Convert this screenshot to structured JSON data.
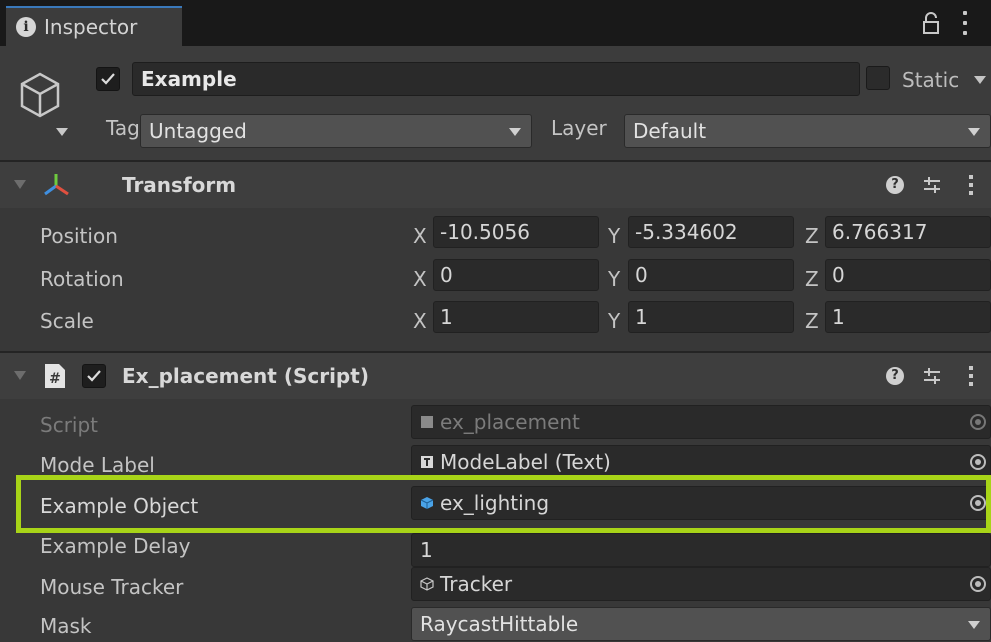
{
  "tab": {
    "title": "Inspector"
  },
  "object": {
    "name": "Example",
    "active": true,
    "static_label": "Static"
  },
  "tag": {
    "label": "Tag",
    "value": "Untagged"
  },
  "layer": {
    "label": "Layer",
    "value": "Default"
  },
  "transform": {
    "title": "Transform",
    "rows": [
      {
        "label": "Position",
        "x": "-10.5056",
        "y": "-5.334602",
        "z": "6.766317"
      },
      {
        "label": "Rotation",
        "x": "0",
        "y": "0",
        "z": "0"
      },
      {
        "label": "Scale",
        "x": "1",
        "y": "1",
        "z": "1"
      }
    ],
    "axes": {
      "x": "X",
      "y": "Y",
      "z": "Z"
    }
  },
  "script_component": {
    "title": "Ex_placement (Script)",
    "enabled": true,
    "fields": [
      {
        "label": "Script",
        "value": "ex_placement"
      },
      {
        "label": "Mode Label",
        "value": "ModeLabel (Text)"
      },
      {
        "label": "Example Object",
        "value": "ex_lighting"
      },
      {
        "label": "Example Delay",
        "value": "1"
      },
      {
        "label": "Mouse Tracker",
        "value": "Tracker"
      },
      {
        "label": "Mask",
        "value": "RaycastHittable"
      }
    ]
  },
  "colors": {
    "highlight": "#a8d418",
    "accent": "#3a79bb",
    "background": "#383838"
  }
}
